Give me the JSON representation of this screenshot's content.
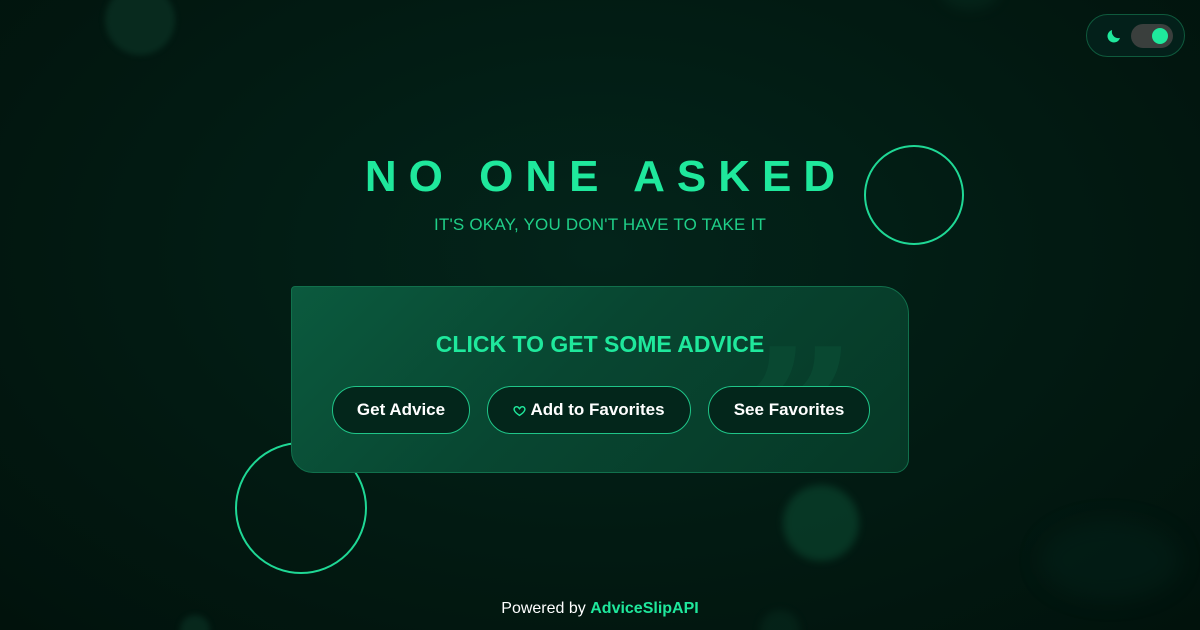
{
  "header": {
    "title": "NO ONE ASKED",
    "subtitle": "IT'S OKAY, YOU DON'T HAVE TO TAKE IT"
  },
  "theme_toggle": {
    "icon": "moon-icon",
    "state": "on"
  },
  "card": {
    "heading": "CLICK TO GET SOME ADVICE",
    "decoration": "close-quote-icon",
    "buttons": {
      "get_advice": "Get Advice",
      "add_favorites": "Add to Favorites",
      "add_favorites_icon": "heart-icon",
      "see_favorites": "See Favorites"
    }
  },
  "footer": {
    "prefix": "Powered by",
    "link": "AdviceSlipAPI"
  },
  "colors": {
    "accent": "#1fe89c",
    "background": "#021a12",
    "card": "#084631"
  }
}
